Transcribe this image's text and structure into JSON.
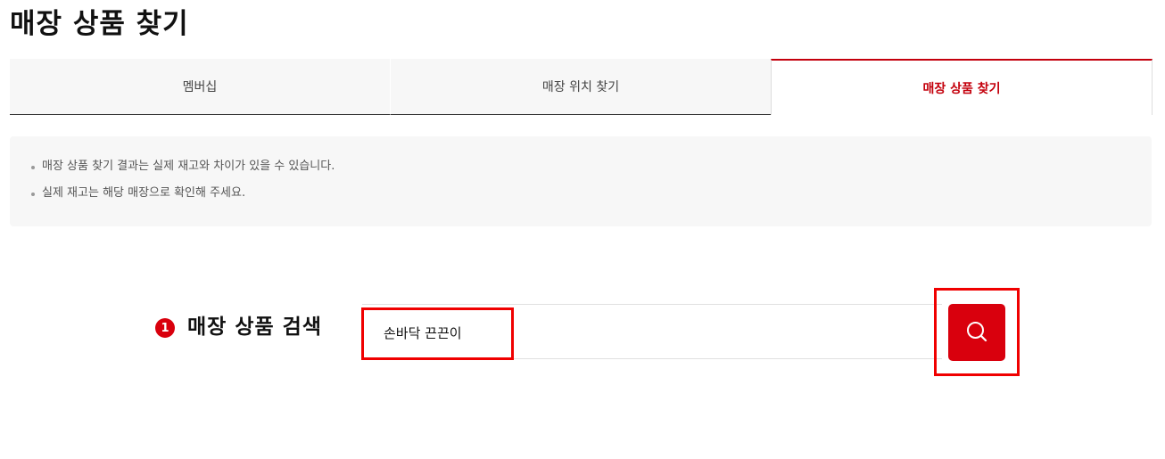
{
  "page": {
    "title": "매장 상품 찾기"
  },
  "tabs": [
    {
      "label": "멤버십",
      "active": false
    },
    {
      "label": "매장 위치 찾기",
      "active": false
    },
    {
      "label": "매장 상품 찾기",
      "active": true
    }
  ],
  "notice": {
    "items": [
      "매장 상품 찾기 결과는 실제 재고와 차이가 있을 수 있습니다.",
      "실제 재고는 해당 매장으로 확인해 주세요."
    ]
  },
  "search": {
    "step_number": "1",
    "label": "매장 상품 검색",
    "input_value": "손바닥 끈끈이",
    "button_icon": "search-icon"
  },
  "colors": {
    "accent": "#d9000d",
    "active_tab": "#c4000c",
    "highlight": "#f00000",
    "notice_bg": "#f7f7f7"
  }
}
